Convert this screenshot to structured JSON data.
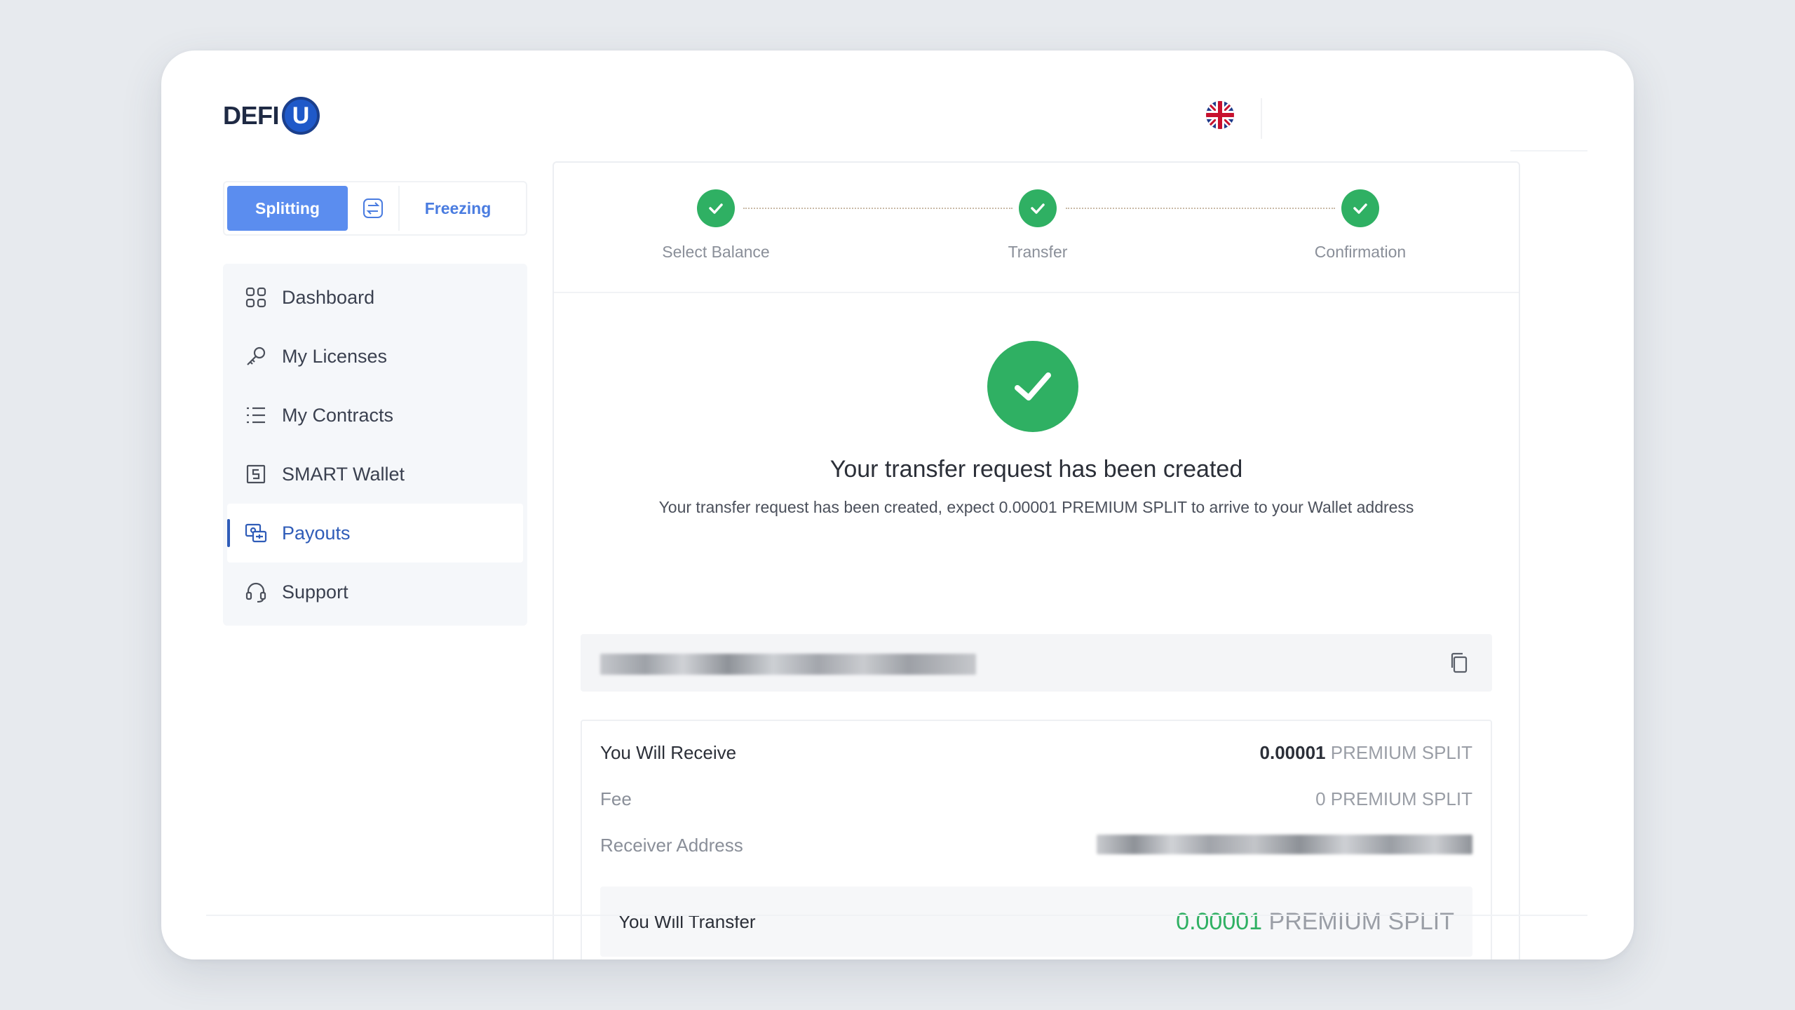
{
  "brand": {
    "logo_text": "DEFI",
    "logo_badge": "U"
  },
  "header": {
    "language_icon": "uk-flag-icon"
  },
  "mode_switch": {
    "splitting_label": "Splitting",
    "freezing_label": "Freezing",
    "swap_icon": "swap-icon"
  },
  "sidebar": {
    "items": [
      {
        "label": "Dashboard",
        "icon": "grid-icon"
      },
      {
        "label": "My Licenses",
        "icon": "key-icon"
      },
      {
        "label": "My Contracts",
        "icon": "list-icon"
      },
      {
        "label": "SMART Wallet",
        "icon": "wallet-icon"
      },
      {
        "label": "Payouts",
        "icon": "payouts-icon",
        "active": true
      },
      {
        "label": "Support",
        "icon": "headset-icon"
      }
    ]
  },
  "steps": [
    {
      "label": "Select Balance",
      "done": true
    },
    {
      "label": "Transfer",
      "done": true
    },
    {
      "label": "Confirmation",
      "done": true
    }
  ],
  "result": {
    "title": "Your transfer request has been created",
    "subtitle": "Your transfer request has been created, expect 0.00001 PREMIUM SPLIT to arrive to your Wallet address"
  },
  "summary": {
    "receive_label": "You Will Receive",
    "receive_amount": "0.00001",
    "receive_unit": "PREMIUM SPLIT",
    "fee_label": "Fee",
    "fee_value": "0 PREMIUM SPLIT",
    "receiver_label": "Receiver Address",
    "transfer_label": "You Will Transfer",
    "transfer_amount": "0.00001",
    "transfer_unit": "PREMIUM SPLIT"
  },
  "colors": {
    "accent": "#5b8def",
    "success": "#2fb063",
    "active_nav": "#2f5cb8"
  }
}
